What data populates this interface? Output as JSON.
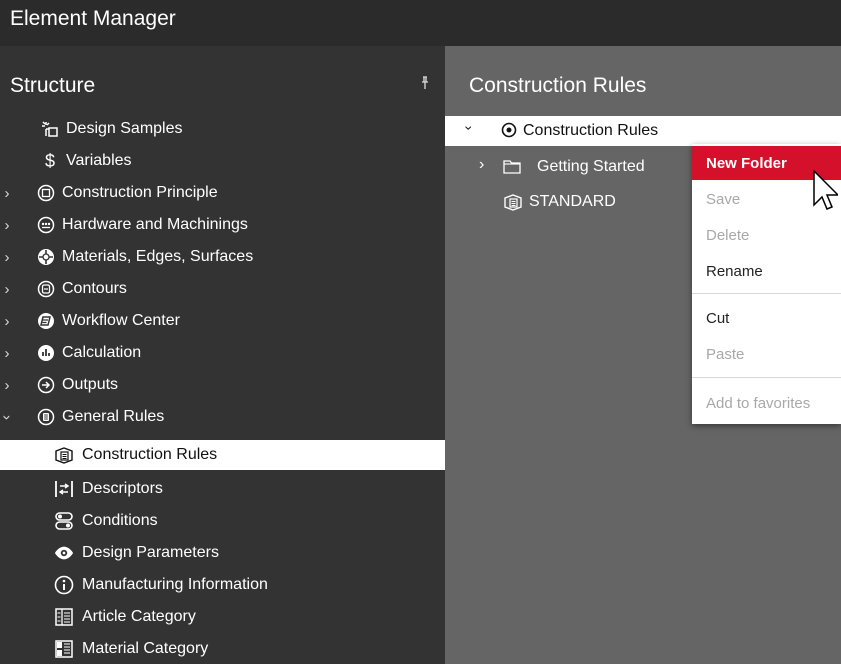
{
  "app": {
    "title": "Element Manager"
  },
  "structure": {
    "title": "Structure",
    "pin_icon": "pin-icon",
    "items": [
      {
        "label": "Design Samples",
        "icon": "design-samples-icon",
        "expandable": false,
        "indent": 1,
        "selected": false
      },
      {
        "label": "Variables",
        "icon": "dollar-icon",
        "expandable": false,
        "indent": 1,
        "selected": false
      },
      {
        "label": "Construction Principle",
        "icon": "construction-principle-icon",
        "expandable": true,
        "indent": 1,
        "selected": false
      },
      {
        "label": "Hardware and Machinings",
        "icon": "hardware-icon",
        "expandable": true,
        "indent": 1,
        "selected": false
      },
      {
        "label": "Materials, Edges, Surfaces",
        "icon": "materials-icon",
        "expandable": true,
        "indent": 1,
        "selected": false
      },
      {
        "label": "Contours",
        "icon": "contours-icon",
        "expandable": true,
        "indent": 1,
        "selected": false
      },
      {
        "label": "Workflow Center",
        "icon": "workflow-icon",
        "expandable": true,
        "indent": 1,
        "selected": false
      },
      {
        "label": "Calculation",
        "icon": "calculation-icon",
        "expandable": true,
        "indent": 1,
        "selected": false
      },
      {
        "label": "Outputs",
        "icon": "outputs-icon",
        "expandable": true,
        "indent": 1,
        "selected": false
      },
      {
        "label": "General Rules",
        "icon": "general-rules-icon",
        "expandable": true,
        "expanded": true,
        "indent": 1,
        "selected": false
      },
      {
        "label": "Construction Rules",
        "icon": "construction-rules-icon",
        "expandable": false,
        "indent": 2,
        "selected": true
      },
      {
        "label": "Descriptors",
        "icon": "descriptors-icon",
        "expandable": false,
        "indent": 2,
        "selected": false
      },
      {
        "label": "Conditions",
        "icon": "conditions-icon",
        "expandable": false,
        "indent": 2,
        "selected": false
      },
      {
        "label": "Design Parameters",
        "icon": "eye-icon",
        "expandable": false,
        "indent": 2,
        "selected": false
      },
      {
        "label": "Manufacturing Information",
        "icon": "info-icon",
        "expandable": false,
        "indent": 2,
        "selected": false
      },
      {
        "label": "Article Category",
        "icon": "article-category-icon",
        "expandable": false,
        "indent": 2,
        "selected": false
      },
      {
        "label": "Material Category",
        "icon": "material-category-icon",
        "expandable": false,
        "indent": 2,
        "selected": false
      }
    ]
  },
  "content": {
    "title": "Construction Rules",
    "tree": [
      {
        "label": "Construction Rules",
        "icon": "target-icon",
        "expanded": true
      },
      {
        "label": "Getting Started",
        "icon": "folder-icon",
        "expandable": true
      },
      {
        "label": "STANDARD",
        "icon": "rule-doc-icon",
        "expandable": false
      }
    ]
  },
  "context_menu": {
    "items": [
      {
        "label": "New Folder",
        "state": "highlighted"
      },
      {
        "label": "Save",
        "state": "disabled"
      },
      {
        "label": "Delete",
        "state": "disabled"
      },
      {
        "label": "Rename",
        "state": "enabled"
      },
      {
        "label": "Cut",
        "state": "enabled"
      },
      {
        "label": "Paste",
        "state": "disabled"
      },
      {
        "label": "Add to favorites",
        "state": "disabled"
      }
    ]
  },
  "colors": {
    "highlight": "#d4102b",
    "left_panel_bg": "#333333",
    "right_panel_bg": "#656565",
    "title_bg": "#2b2b2b"
  }
}
